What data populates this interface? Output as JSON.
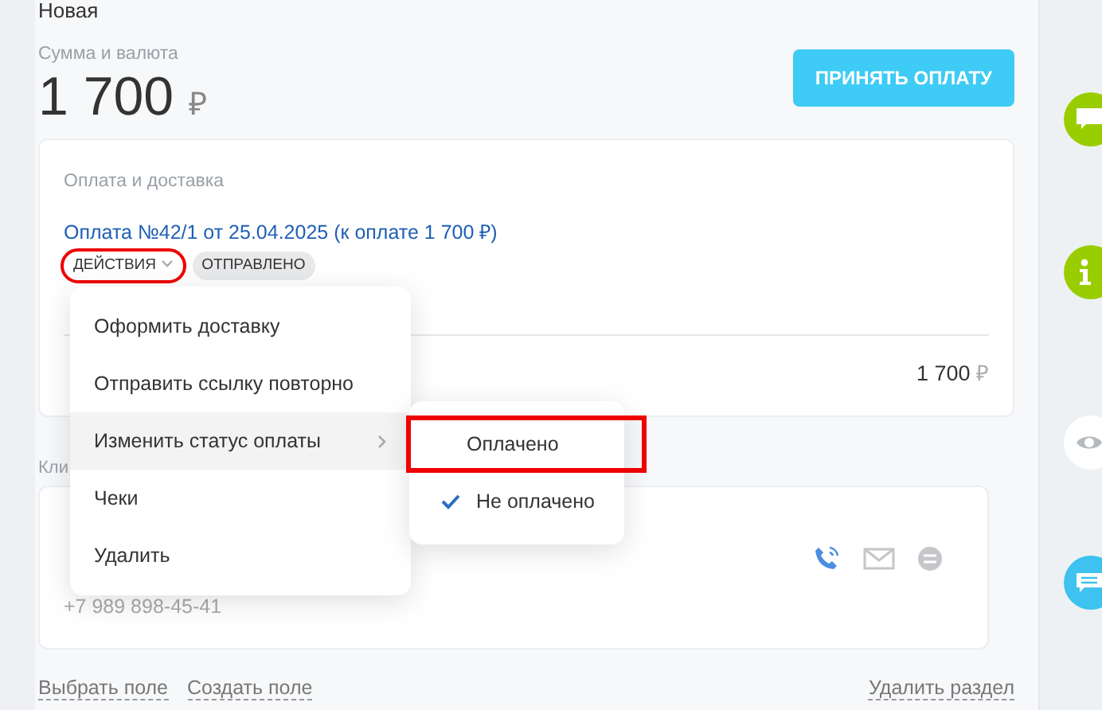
{
  "header": {
    "status": "Новая"
  },
  "amount": {
    "label": "Сумма и валюта",
    "value": "1 700",
    "currency": "₽"
  },
  "accept_button": "ПРИНЯТЬ ОПЛАТУ",
  "payment_section": {
    "title": "Оплата и доставка",
    "payment_link": "Оплата №42/1 от 25.04.2025 (к оплате 1 700 ₽)",
    "actions_button": {
      "label": "ДЕЙСТВИЯ",
      "highlighted": true
    },
    "status_badge": "ОТПРАВЛЕНО",
    "total": {
      "value": "1 700",
      "currency": "₽"
    }
  },
  "actions_menu": {
    "items": [
      {
        "label": "Оформить доставку",
        "selected": false,
        "has_submenu": false
      },
      {
        "label": "Отправить ссылку повторно",
        "selected": false,
        "has_submenu": false
      },
      {
        "label": "Изменить статус оплаты",
        "selected": true,
        "has_submenu": true
      },
      {
        "label": "Чеки",
        "selected": false,
        "has_submenu": false
      },
      {
        "label": "Удалить",
        "selected": false,
        "has_submenu": false
      }
    ]
  },
  "status_submenu": {
    "items": [
      {
        "label": "Оплачено",
        "checked": false,
        "highlighted": true
      },
      {
        "label": "Не оплачено",
        "checked": true,
        "highlighted": false
      }
    ]
  },
  "client_section": {
    "title": "Кли",
    "phone": "+7 989 898-45-41"
  },
  "footer_links": [
    "Выбрать поле",
    "Создать поле"
  ],
  "delete_link": "Удалить раздел"
}
